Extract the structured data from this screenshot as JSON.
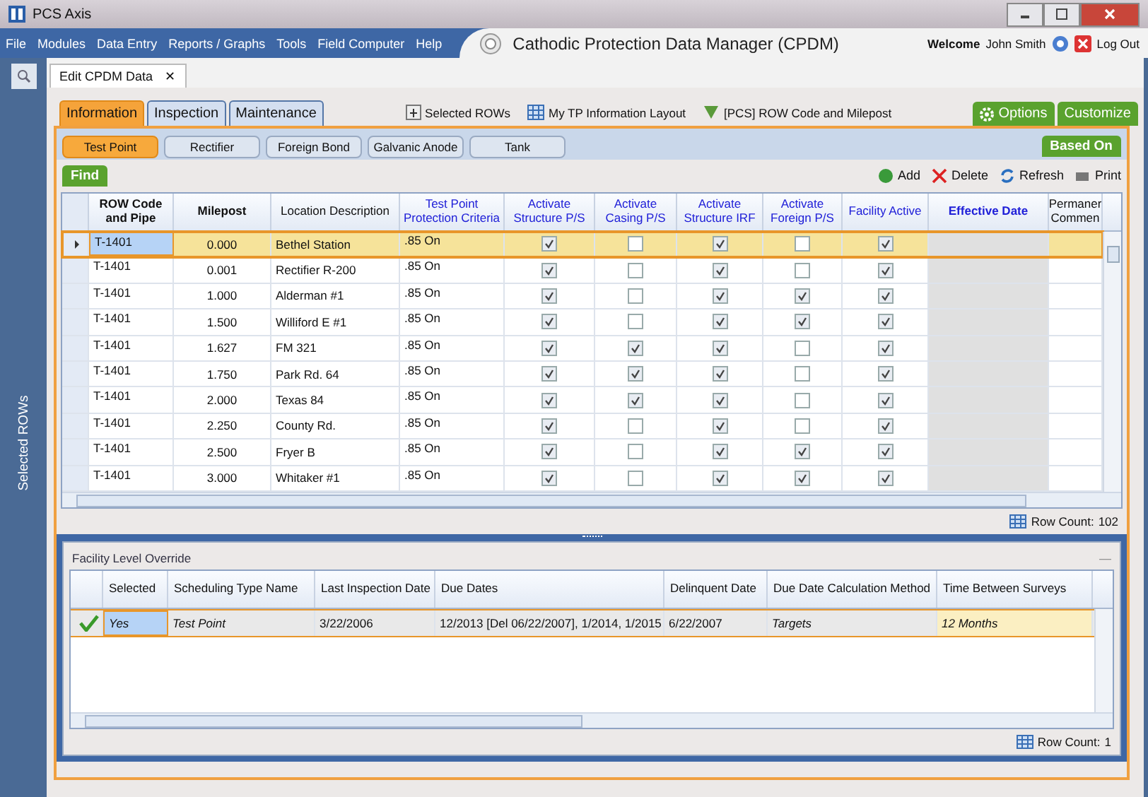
{
  "window": {
    "title": "PCS Axis"
  },
  "menu": [
    "File",
    "Modules",
    "Data Entry",
    "Reports / Graphs",
    "Tools",
    "Field Computer",
    "Help"
  ],
  "app_title": "Cathodic Protection Data Manager (CPDM)",
  "user": {
    "welcome": "Welcome",
    "name": "John Smith",
    "logout": "Log Out"
  },
  "doc_tabs": [
    {
      "label": "Edit CPDM Data",
      "close": "✕"
    }
  ],
  "sidebar": {
    "label": "Selected ROWs"
  },
  "main_tabs": [
    {
      "label": "Information",
      "selected": true
    },
    {
      "label": "Inspection",
      "selected": false
    },
    {
      "label": "Maintenance",
      "selected": false
    }
  ],
  "links": [
    "Selected ROWs",
    "My TP Information Layout",
    "[PCS] ROW Code and Milepost"
  ],
  "options_button": "Options",
  "customize_button": "Customize",
  "sub_tabs": [
    {
      "label": "Test Point",
      "selected": true
    },
    {
      "label": "Rectifier",
      "selected": false
    },
    {
      "label": "Foreign Bond",
      "selected": false
    },
    {
      "label": "Galvanic Anode",
      "selected": false
    },
    {
      "label": "Tank",
      "selected": false
    }
  ],
  "based_on_button": "Based On",
  "find_button": "Find",
  "toolbar": [
    "Add",
    "Delete",
    "Refresh",
    "Print"
  ],
  "grid": {
    "columns": [
      {
        "label": "ROW Code and Pipe",
        "bold": true,
        "highlighted": false
      },
      {
        "label": "Milepost",
        "bold": true,
        "highlighted": false
      },
      {
        "label": "Location Description",
        "bold": false,
        "highlighted": false
      },
      {
        "label": "Test Point Protection Criteria",
        "bold": false,
        "highlighted": true
      },
      {
        "label": "Activate Structure P/S",
        "bold": false,
        "highlighted": true
      },
      {
        "label": "Activate Casing P/S",
        "bold": false,
        "highlighted": true
      },
      {
        "label": "Activate Structure IRF",
        "bold": false,
        "highlighted": true
      },
      {
        "label": "Activate Foreign P/S",
        "bold": false,
        "highlighted": true
      },
      {
        "label": "Facility Active",
        "bold": false,
        "highlighted": true
      },
      {
        "label": "Effective Date",
        "bold": true,
        "highlighted": true
      },
      {
        "label": "Permaner Commen",
        "bold": false,
        "highlighted": false
      }
    ],
    "rows": [
      {
        "selected": true,
        "row_code": "T-1401",
        "milepost": "0.000",
        "location": "Bethel Station",
        "criteria": ".85 On",
        "checks": [
          true,
          false,
          true,
          false,
          true
        ]
      },
      {
        "selected": false,
        "row_code": "T-1401",
        "milepost": "0.001",
        "location": "Rectifier R-200",
        "criteria": ".85 On",
        "checks": [
          true,
          false,
          true,
          false,
          true
        ]
      },
      {
        "selected": false,
        "row_code": "T-1401",
        "milepost": "1.000",
        "location": "Alderman #1",
        "criteria": ".85 On",
        "checks": [
          true,
          false,
          true,
          true,
          true
        ]
      },
      {
        "selected": false,
        "row_code": "T-1401",
        "milepost": "1.500",
        "location": "Williford E #1",
        "criteria": ".85 On",
        "checks": [
          true,
          false,
          true,
          true,
          true
        ]
      },
      {
        "selected": false,
        "row_code": "T-1401",
        "milepost": "1.627",
        "location": "FM 321",
        "criteria": ".85 On",
        "checks": [
          true,
          true,
          true,
          false,
          true
        ]
      },
      {
        "selected": false,
        "row_code": "T-1401",
        "milepost": "1.750",
        "location": "Park Rd. 64",
        "criteria": ".85 On",
        "checks": [
          true,
          true,
          true,
          false,
          true
        ]
      },
      {
        "selected": false,
        "row_code": "T-1401",
        "milepost": "2.000",
        "location": "Texas 84",
        "criteria": ".85 On",
        "checks": [
          true,
          true,
          true,
          false,
          true
        ]
      },
      {
        "selected": false,
        "row_code": "T-1401",
        "milepost": "2.250",
        "location": "County Rd.",
        "criteria": ".85 On",
        "checks": [
          true,
          false,
          true,
          false,
          true
        ]
      },
      {
        "selected": false,
        "row_code": "T-1401",
        "milepost": "2.500",
        "location": "Fryer B",
        "criteria": ".85 On",
        "checks": [
          true,
          false,
          true,
          true,
          true
        ]
      },
      {
        "selected": false,
        "row_code": "T-1401",
        "milepost": "3.000",
        "location": "Whitaker #1",
        "criteria": ".85 On",
        "checks": [
          true,
          false,
          true,
          true,
          true
        ]
      }
    ],
    "row_count_label": "Row Count:",
    "row_count": "102"
  },
  "override": {
    "title": "Facility Level Override",
    "minimize": "—",
    "columns": [
      "Selected",
      "Scheduling Type Name",
      "Last Inspection Date",
      "Due Dates",
      "Delinquent Date",
      "Due Date Calculation Method",
      "Time Between Surveys"
    ],
    "rows": [
      {
        "selected": true,
        "cells": [
          "Yes",
          "Test Point",
          "3/22/2006",
          "12/2013 [Del 06/22/2007], 1/2014, 1/2015",
          "6/22/2007",
          "Targets",
          "12 Months"
        ]
      }
    ],
    "row_count_label": "Row Count:",
    "row_count": "1"
  }
}
